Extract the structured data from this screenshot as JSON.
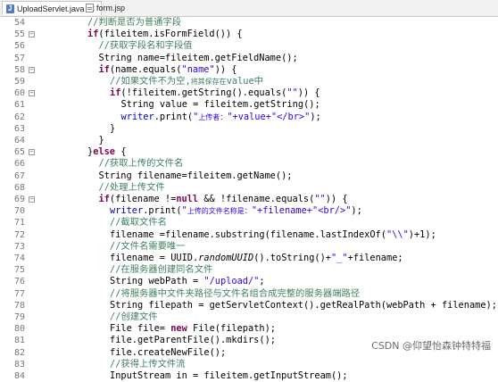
{
  "tabs": [
    {
      "label": "UploadServlet.java",
      "icon": "java-file-icon",
      "active": true
    },
    {
      "label": "form.jsp",
      "icon": "jsp-file-icon",
      "active": false
    }
  ],
  "colors": {
    "keyword": "#7f0055",
    "comment": "#3f7f5f",
    "string": "#2a00ff",
    "field": "#0000c0"
  },
  "lines": [
    {
      "n": "54",
      "fold": "",
      "indent": 8,
      "tokens": [
        {
          "t": "//判断是否为普通字段",
          "c": "cm"
        }
      ]
    },
    {
      "n": "55",
      "fold": "",
      "indent": 8,
      "tokens": [
        {
          "t": "if",
          "c": "kw"
        },
        {
          "t": "(fileitem.isFormField()) {"
        }
      ]
    },
    {
      "n": "56",
      "fold": "",
      "indent": 10,
      "tokens": [
        {
          "t": "//获取字段名和字段值",
          "c": "cm"
        }
      ]
    },
    {
      "n": "57",
      "fold": "",
      "indent": 10,
      "tokens": [
        {
          "t": "String name=fileitem.getFieldName();"
        }
      ]
    },
    {
      "n": "58",
      "fold": "",
      "indent": 10,
      "tokens": [
        {
          "t": "if",
          "c": "kw"
        },
        {
          "t": "(name.equals("
        },
        {
          "t": "\"name\"",
          "c": "str"
        },
        {
          "t": ")) {"
        }
      ]
    },
    {
      "n": "59",
      "fold": "",
      "indent": 12,
      "tokens": [
        {
          "t": "//如果文件不为空,",
          "c": "cm"
        },
        {
          "t": "将其保存在",
          "c": "cm sm"
        },
        {
          "t": "value中",
          "c": "cm"
        }
      ]
    },
    {
      "n": "60",
      "fold": "",
      "indent": 12,
      "tokens": [
        {
          "t": "if",
          "c": "kw"
        },
        {
          "t": "(!fileitem.getString().equals("
        },
        {
          "t": "\"\"",
          "c": "str"
        },
        {
          "t": ")) {"
        }
      ]
    },
    {
      "n": "61",
      "fold": "",
      "indent": 14,
      "tokens": [
        {
          "t": "String value = fileitem.getString();"
        }
      ]
    },
    {
      "n": "62",
      "fold": "",
      "indent": 14,
      "tokens": [
        {
          "t": "writer",
          "c": "fld"
        },
        {
          "t": ".print("
        },
        {
          "t": "\"",
          "c": "str"
        },
        {
          "t": "上传者：",
          "c": "str sm"
        },
        {
          "t": "\"+value+\"</br>\"",
          "c": "str"
        },
        {
          "t": ");"
        }
      ]
    },
    {
      "n": "63",
      "fold": "",
      "indent": 12,
      "tokens": [
        {
          "t": "}"
        }
      ]
    },
    {
      "n": "64",
      "fold": "",
      "indent": 10,
      "tokens": [
        {
          "t": "}"
        }
      ]
    },
    {
      "n": "65",
      "fold": "",
      "indent": 8,
      "tokens": [
        {
          "t": "}"
        },
        {
          "t": "else",
          "c": "kw"
        },
        {
          "t": " {"
        }
      ]
    },
    {
      "n": "66",
      "fold": "",
      "indent": 10,
      "tokens": [
        {
          "t": "//获取上传的文件名",
          "c": "cm"
        }
      ]
    },
    {
      "n": "67",
      "fold": "",
      "indent": 10,
      "tokens": [
        {
          "t": "String filename=fileitem.getName();"
        }
      ]
    },
    {
      "n": "68",
      "fold": "",
      "indent": 10,
      "tokens": [
        {
          "t": "//处理上传文件",
          "c": "cm"
        }
      ]
    },
    {
      "n": "69",
      "fold": "",
      "indent": 10,
      "tokens": [
        {
          "t": "if",
          "c": "kw"
        },
        {
          "t": "(filename !="
        },
        {
          "t": "null",
          "c": "kw"
        },
        {
          "t": " && !filename.equals("
        },
        {
          "t": "\"\"",
          "c": "str"
        },
        {
          "t": ")) {"
        }
      ]
    },
    {
      "n": "70",
      "fold": "",
      "indent": 12,
      "tokens": [
        {
          "t": "writer",
          "c": "fld"
        },
        {
          "t": ".print("
        },
        {
          "t": "\"",
          "c": "str"
        },
        {
          "t": "上传的文件名称是：",
          "c": "str sm"
        },
        {
          "t": "\"+filename+\"<br/>\"",
          "c": "str"
        },
        {
          "t": ");"
        }
      ]
    },
    {
      "n": "71",
      "fold": "",
      "indent": 12,
      "tokens": [
        {
          "t": "//截取文件名",
          "c": "cm"
        }
      ]
    },
    {
      "n": "72",
      "fold": "",
      "indent": 12,
      "tokens": [
        {
          "t": "filename =filename.substring(filename.lastIndexOf("
        },
        {
          "t": "\"\\\\\"",
          "c": "str"
        },
        {
          "t": ")+1);"
        }
      ]
    },
    {
      "n": "73",
      "fold": "",
      "indent": 12,
      "tokens": [
        {
          "t": "//文件名需要唯一",
          "c": "cm"
        }
      ]
    },
    {
      "n": "74",
      "fold": "",
      "indent": 12,
      "tokens": [
        {
          "t": "filename = UUID."
        },
        {
          "t": "randomUUID",
          "c": "it"
        },
        {
          "t": "().toString()+"
        },
        {
          "t": "\"_\"",
          "c": "str"
        },
        {
          "t": "+filename;"
        }
      ]
    },
    {
      "n": "75",
      "fold": "",
      "indent": 12,
      "tokens": [
        {
          "t": "//在服务器创建同名文件",
          "c": "cm"
        }
      ]
    },
    {
      "n": "76",
      "fold": "",
      "indent": 12,
      "tokens": [
        {
          "t": "String webPath = "
        },
        {
          "t": "\"/upload/\"",
          "c": "str"
        },
        {
          "t": ";"
        }
      ]
    },
    {
      "n": "77",
      "fold": "",
      "indent": 12,
      "tokens": [
        {
          "t": "//将服务器中文件夹路径与文件名组合成完整的服务器端路径",
          "c": "cm"
        }
      ]
    },
    {
      "n": "78",
      "fold": "",
      "indent": 12,
      "tokens": [
        {
          "t": "String filepath = getServletContext().getRealPath(webPath + filename);"
        }
      ]
    },
    {
      "n": "79",
      "fold": "",
      "indent": 12,
      "tokens": [
        {
          "t": "//创建文件",
          "c": "cm"
        }
      ]
    },
    {
      "n": "80",
      "fold": "",
      "indent": 12,
      "tokens": [
        {
          "t": "File file= "
        },
        {
          "t": "new",
          "c": "kw"
        },
        {
          "t": " File(filepath);"
        }
      ]
    },
    {
      "n": "81",
      "fold": "",
      "indent": 12,
      "tokens": [
        {
          "t": "file.getParentFile().mkdirs();"
        }
      ]
    },
    {
      "n": "82",
      "fold": "",
      "indent": 12,
      "tokens": [
        {
          "t": "file.createNewFile();"
        }
      ]
    },
    {
      "n": "83",
      "fold": "",
      "indent": 12,
      "tokens": [
        {
          "t": "//获得上传文件流",
          "c": "cm"
        }
      ]
    },
    {
      "n": "84",
      "fold": "",
      "indent": 12,
      "tokens": [
        {
          "t": "InputStream in = fileitem.getInputStream();"
        }
      ]
    }
  ],
  "watermark": "CSDN @仰望怡森钟特特福"
}
